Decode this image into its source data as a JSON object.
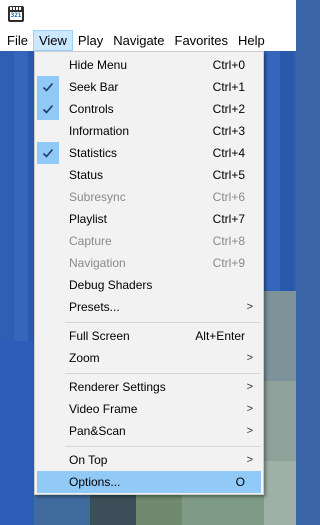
{
  "app": {
    "icon_label": "321"
  },
  "menubar": {
    "items": [
      {
        "label": "File"
      },
      {
        "label": "View"
      },
      {
        "label": "Play"
      },
      {
        "label": "Navigate"
      },
      {
        "label": "Favorites"
      },
      {
        "label": "Help"
      }
    ]
  },
  "view_menu": {
    "items": [
      {
        "label": "Hide Menu",
        "accel": "Ctrl+0",
        "checked": false,
        "disabled": false
      },
      {
        "label": "Seek Bar",
        "accel": "Ctrl+1",
        "checked": true,
        "disabled": false
      },
      {
        "label": "Controls",
        "accel": "Ctrl+2",
        "checked": true,
        "disabled": false
      },
      {
        "label": "Information",
        "accel": "Ctrl+3",
        "checked": false,
        "disabled": false
      },
      {
        "label": "Statistics",
        "accel": "Ctrl+4",
        "checked": true,
        "disabled": false
      },
      {
        "label": "Status",
        "accel": "Ctrl+5",
        "checked": false,
        "disabled": false
      },
      {
        "label": "Subresync",
        "accel": "Ctrl+6",
        "checked": false,
        "disabled": true
      },
      {
        "label": "Playlist",
        "accel": "Ctrl+7",
        "checked": false,
        "disabled": false
      },
      {
        "label": "Capture",
        "accel": "Ctrl+8",
        "checked": false,
        "disabled": true
      },
      {
        "label": "Navigation",
        "accel": "Ctrl+9",
        "checked": false,
        "disabled": true
      },
      {
        "label": "Debug Shaders",
        "accel": "",
        "checked": false,
        "disabled": false
      },
      {
        "label": "Presets...",
        "accel": "",
        "submenu": true
      },
      {
        "label": "Full Screen",
        "accel": "Alt+Enter"
      },
      {
        "label": "Zoom",
        "accel": "",
        "submenu": true
      },
      {
        "label": "Renderer Settings",
        "accel": "",
        "submenu": true
      },
      {
        "label": "Video Frame",
        "accel": "",
        "submenu": true
      },
      {
        "label": "Pan&Scan",
        "accel": "",
        "submenu": true
      },
      {
        "label": "On Top",
        "accel": "",
        "submenu": true
      },
      {
        "label": "Options...",
        "accel": "O",
        "highlighted": true
      }
    ]
  },
  "colors": {
    "menu_bg": "#f2f2f2",
    "highlight": "#91c9f7",
    "check_bg": "#90c8f6",
    "disabled_text": "#8a8a8a",
    "video_blue": "#3463b6"
  }
}
